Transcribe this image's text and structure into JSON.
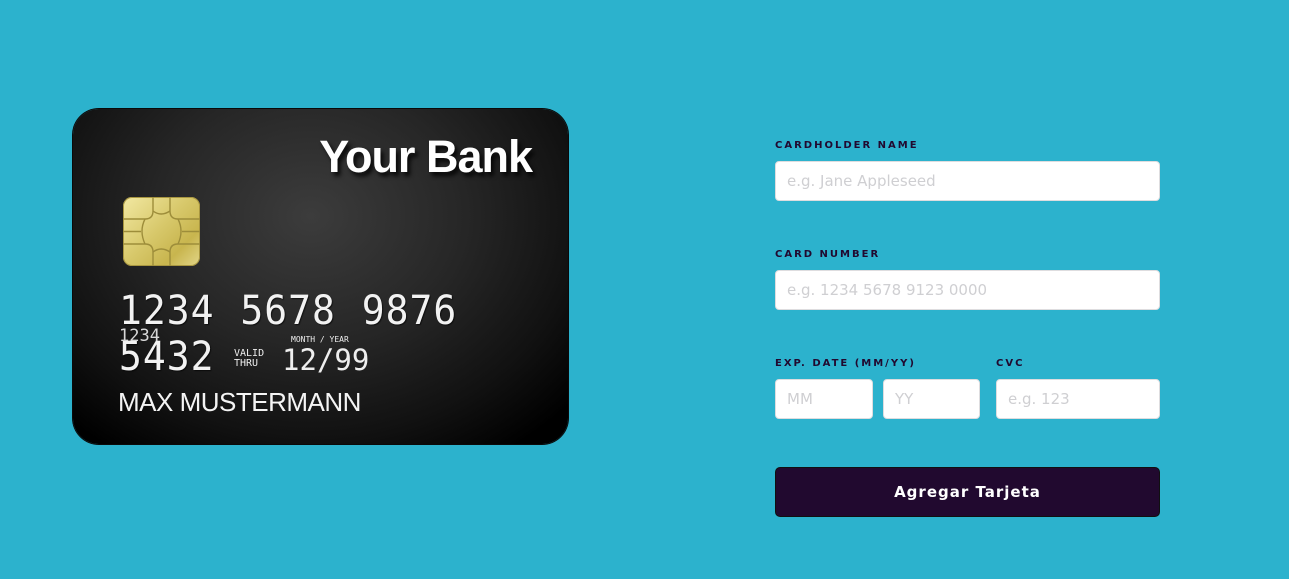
{
  "card": {
    "bank_name": "Your Bank",
    "number": "1234 5678 9876 5432",
    "number_small": "1234",
    "valid_label": "VALID THRU",
    "month_year_label": "MONTH / YEAR",
    "expiry": "12/99",
    "holder_name": "MAX MUSTERMANN",
    "chip_icon": "chip-icon"
  },
  "form": {
    "cardholder_label": "CARDHOLDER NAME",
    "cardholder_placeholder": "e.g. Jane Appleseed",
    "cardholder_value": "",
    "card_number_label": "CARD NUMBER",
    "card_number_placeholder": "e.g. 1234 5678 9123 0000",
    "card_number_value": "",
    "exp_label": "EXP. DATE (MM/YY)",
    "mm_placeholder": "MM",
    "yy_placeholder": "YY",
    "cvc_label": "CVC",
    "cvc_placeholder": "e.g. 123",
    "submit_label": "Agregar Tarjeta"
  },
  "colors": {
    "background": "#2cb2cd",
    "button": "#21092f",
    "label_text": "#21092f"
  }
}
